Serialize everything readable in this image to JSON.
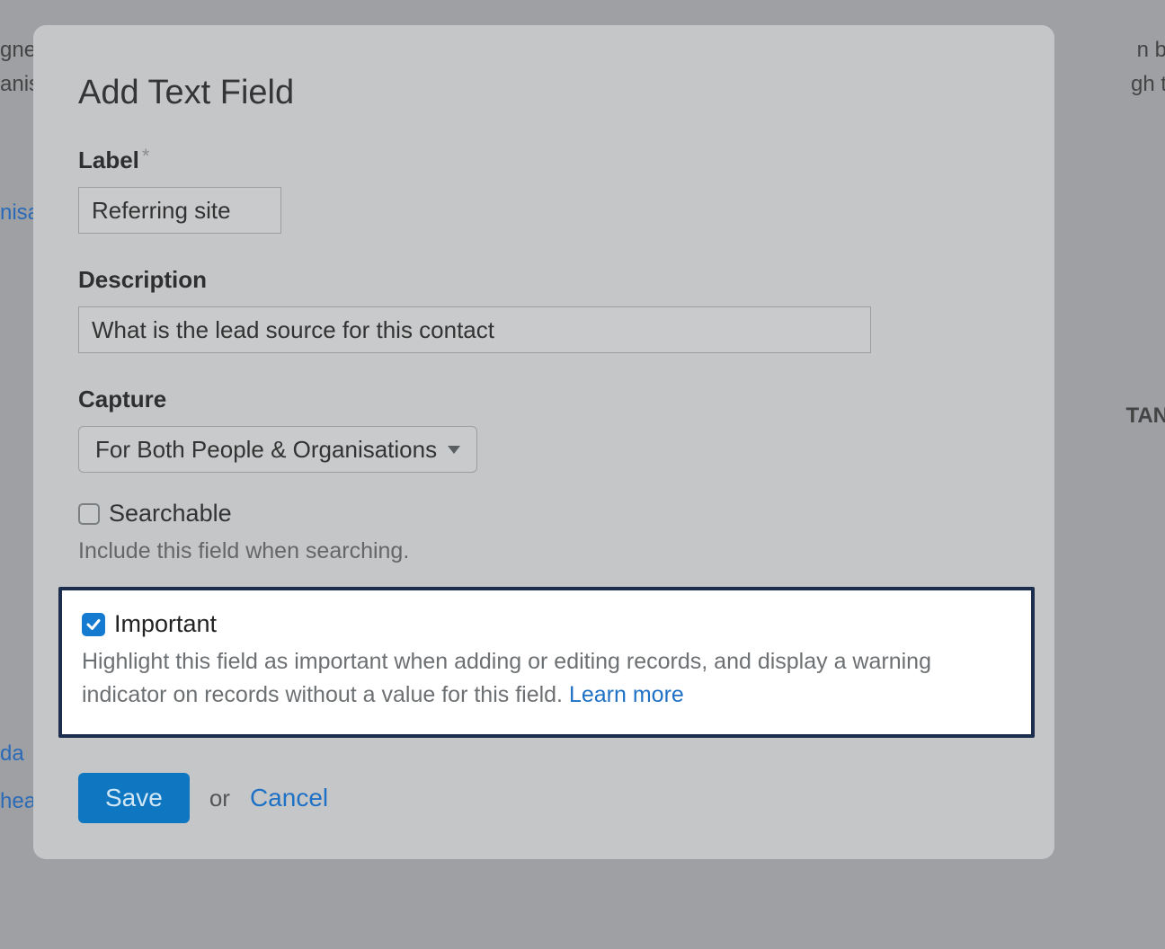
{
  "bg": {
    "frag1": "gne",
    "frag2": "anis",
    "frag3": "nisa",
    "frag4": "da",
    "frag5": "hea",
    "frag6": "n b",
    "frag7": "gh t",
    "frag8": "TAN"
  },
  "modal": {
    "title": "Add Text Field",
    "label_field": {
      "label": "Label",
      "required_mark": "*",
      "value": "Referring site"
    },
    "description_field": {
      "label": "Description",
      "value": "What is the lead source for this contact"
    },
    "capture_field": {
      "label": "Capture",
      "value": "For Both People & Organisations"
    },
    "searchable": {
      "label": "Searchable",
      "helper": "Include this field when searching.",
      "checked": false
    },
    "important": {
      "label": "Important",
      "helper": "Highlight this field as important when adding or editing records, and display a warning indicator on records without a value for this field. ",
      "learn_more": "Learn more",
      "checked": true
    },
    "footer": {
      "save": "Save",
      "or": "or",
      "cancel": "Cancel"
    }
  }
}
